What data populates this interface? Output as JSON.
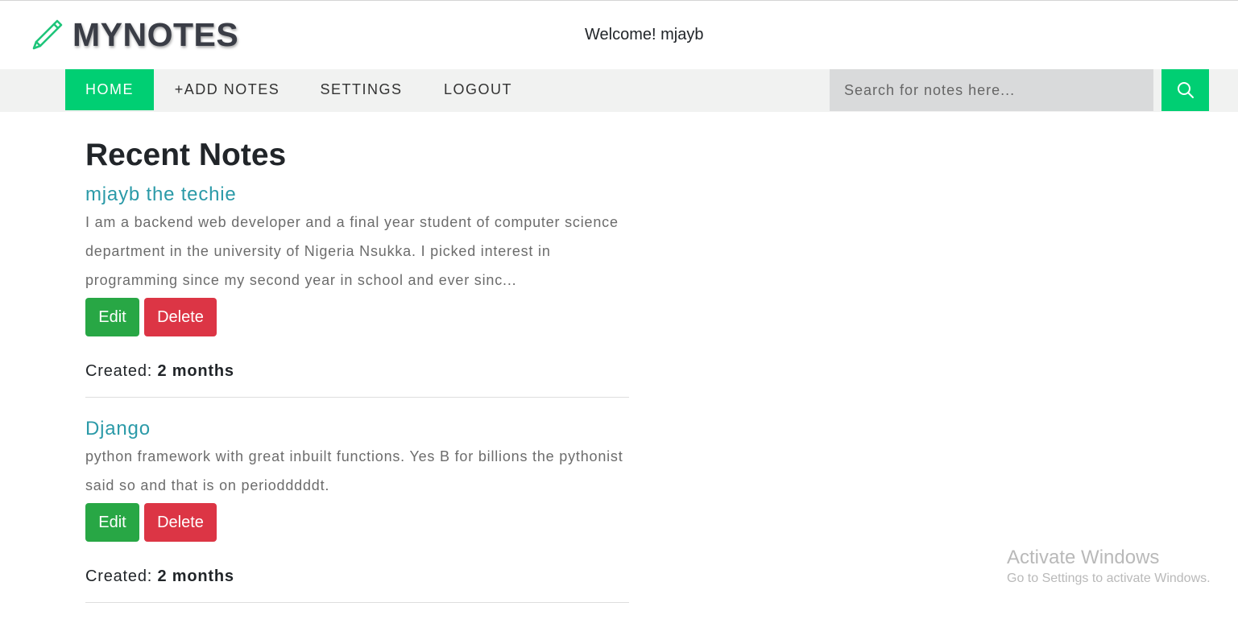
{
  "header": {
    "brand": "MYNOTES",
    "welcome": "Welcome! mjayb"
  },
  "nav": {
    "home": "HOME",
    "add_notes": "+ADD NOTES",
    "settings": "SETTINGS",
    "logout": "LOGOUT",
    "search_placeholder": "Search for notes here...",
    "search_icon": "search-icon"
  },
  "main": {
    "title": "Recent Notes",
    "notes": [
      {
        "title": "mjayb the techie",
        "body": "I am a backend web developer and a final year student of computer science department in the university of Nigeria Nsukka. I picked interest in programming since my second year in school and ever sinc...",
        "edit_label": "Edit",
        "delete_label": "Delete",
        "created_label": "Created: ",
        "created_value": "2 months"
      },
      {
        "title": "Django",
        "body": "python framework with great inbuilt functions. Yes B for billions the pythonist said so and that is on periodddddt.",
        "edit_label": "Edit",
        "delete_label": "Delete",
        "created_label": "Created: ",
        "created_value": "2 months"
      }
    ]
  },
  "watermark": {
    "title": "Activate Windows",
    "subtitle": "Go to Settings to activate Windows."
  },
  "colors": {
    "accent": "#00cf73",
    "note_title": "#2b9aa8",
    "edit": "#28a745",
    "delete": "#dc3545"
  }
}
